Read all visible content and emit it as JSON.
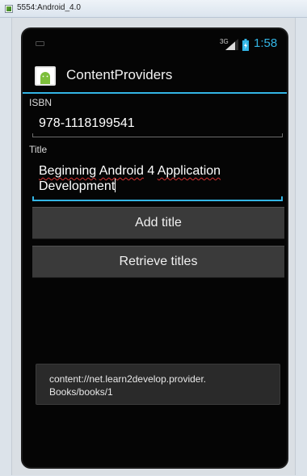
{
  "window": {
    "title": "5554:Android_4.0"
  },
  "statusbar": {
    "network": "3G",
    "time": "1:58",
    "icons": [
      "notification-icon",
      "signal-icon",
      "battery-charging-icon"
    ],
    "clock_color": "#33b5e5"
  },
  "actionbar": {
    "app_icon": "android-app-icon",
    "title": "ContentProviders",
    "accent_color": "#33b5e5"
  },
  "form": {
    "isbn_label": "ISBN",
    "isbn_value": "978-1118199541",
    "title_label": "Title",
    "title_words": [
      "Beginning",
      " ",
      "Android",
      " 4 ",
      "Application",
      " Development"
    ]
  },
  "buttons": {
    "add_title": "Add title",
    "retrieve_titles": "Retrieve titles"
  },
  "toast": {
    "line1": "content://net.learn2develop.provider.",
    "line2": "Books/books/1"
  }
}
